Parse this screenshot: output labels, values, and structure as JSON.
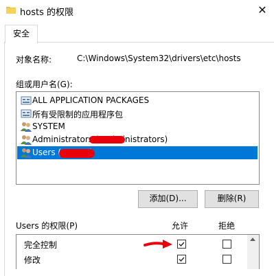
{
  "window": {
    "title": "hosts 的权限",
    "close_glyph": "✕"
  },
  "tabs": [
    {
      "label": "安全"
    }
  ],
  "object": {
    "label": "对象名称:",
    "value": "C:\\Windows\\System32\\drivers\\etc\\hosts"
  },
  "groups": {
    "label": "组或用户名(G):",
    "items": [
      {
        "label": "ALL APPLICATION PACKAGES",
        "icon": "app-packages-icon"
      },
      {
        "label": "所有受限制的应用程序包",
        "icon": "app-packages-icon"
      },
      {
        "label": "SYSTEM",
        "icon": "users-group-icon"
      },
      {
        "label": "Administrators (          \\Administrators)",
        "icon": "users-group-icon"
      },
      {
        "label": "Users (          \\Users)",
        "icon": "users-group-icon"
      }
    ],
    "selected_index": 4
  },
  "buttons": {
    "add": "添加(D)...",
    "remove": "删除(R)"
  },
  "permissions": {
    "title": "Users 的权限(P)",
    "allow_header": "允许",
    "deny_header": "拒绝",
    "rows": [
      {
        "name": "完全控制",
        "allow": true,
        "deny": false
      },
      {
        "name": "修改",
        "allow": true,
        "deny": false
      }
    ]
  },
  "colors": {
    "selection": "#0078d7",
    "annotation_red": "#e8000a",
    "folder": "#f0c040"
  }
}
